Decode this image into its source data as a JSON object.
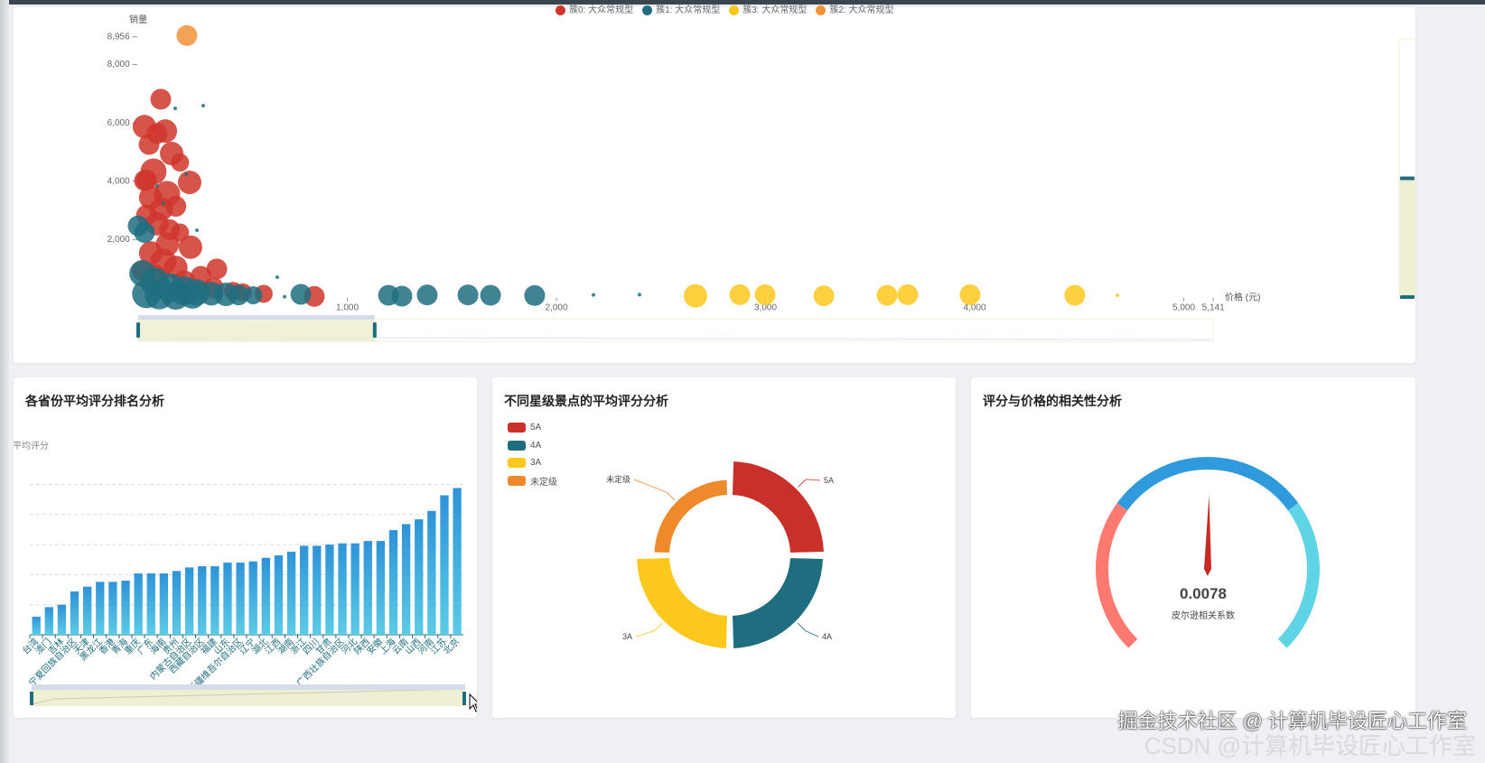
{
  "scatter_panel": {
    "legend": [
      {
        "label": "簇0: 大众常规型",
        "color": "#d0362b"
      },
      {
        "label": "簇1: 大众常规型",
        "color": "#1f6e80"
      },
      {
        "label": "簇3: 大众常规型",
        "color": "#fcc81c"
      },
      {
        "label": "簇2: 大众常规型",
        "color": "#f29338"
      }
    ]
  },
  "bar_panel": {
    "title": "各省份平均评分排名分析"
  },
  "donut_panel": {
    "title": "不同星级景点的平均评分分析"
  },
  "gauge_panel": {
    "title": "评分与价格的相关性分析"
  },
  "watermark": {
    "primary": "掘金技术社区 @ 计算机毕设匠心工作室",
    "secondary": "CSDN @计算机毕设匠心工作室"
  },
  "chart_data": [
    {
      "type": "scatter",
      "xlabel": "价格 (元)",
      "ylabel": "销量",
      "xlim": [
        0,
        5141
      ],
      "ylim": [
        0,
        8956
      ],
      "xticks": [
        "1,000",
        "2,000",
        "3,000",
        "4,000",
        "5,000",
        "5,141"
      ],
      "yticks": [
        "2,000",
        "4,000",
        "6,000",
        "8,000",
        "8,956"
      ],
      "xzoom_range_pct": [
        0,
        22
      ],
      "yzoom_range_pct": [
        0,
        46
      ],
      "series": [
        {
          "name": "簇0: 大众常规型",
          "color": "#d0362b",
          "points": [
            [
              108,
              6770,
              5
            ],
            [
              30,
              5830,
              6
            ],
            [
              130,
              5680,
              6
            ],
            [
              52,
              5220,
              5
            ],
            [
              160,
              4910,
              6
            ],
            [
              90,
              5600,
              5
            ],
            [
              200,
              4600,
              4
            ],
            [
              73,
              4290,
              7
            ],
            [
              30,
              3980,
              5
            ],
            [
              246,
              3920,
              6
            ],
            [
              138,
              3520,
              7
            ],
            [
              60,
              3400,
              6
            ],
            [
              110,
              3000,
              6
            ],
            [
              180,
              3100,
              5
            ],
            [
              40,
              2800,
              5
            ],
            [
              90,
              2500,
              6
            ],
            [
              150,
              2300,
              5
            ],
            [
              200,
              2200,
              4
            ],
            [
              250,
              1700,
              6
            ],
            [
              60,
              1500,
              6
            ],
            [
              120,
              1200,
              7
            ],
            [
              180,
              1000,
              6
            ],
            [
              376,
              950,
              5
            ],
            [
              300,
              700,
              5
            ],
            [
              20,
              900,
              5
            ],
            [
              454,
              200,
              4
            ],
            [
              500,
              150,
              4
            ],
            [
              600,
              100,
              4
            ],
            [
              842,
              10,
              5
            ],
            [
              80,
              700,
              6
            ],
            [
              220,
              500,
              6
            ],
            [
              360,
              300,
              5
            ],
            [
              140,
              1800,
              6
            ],
            [
              40,
              4000,
              5
            ]
          ]
        },
        {
          "name": "簇1: 大众常规型",
          "color": "#1f6e80",
          "points": [
            [
              0,
              2430,
              5
            ],
            [
              30,
              2200,
              5
            ],
            [
              20,
              800,
              7
            ],
            [
              80,
              500,
              8
            ],
            [
              150,
              300,
              8
            ],
            [
              220,
              200,
              8
            ],
            [
              280,
              150,
              7
            ],
            [
              350,
              100,
              6
            ],
            [
              420,
              80,
              6
            ],
            [
              40,
              100,
              8
            ],
            [
              100,
              60,
              8
            ],
            [
              180,
              50,
              8
            ],
            [
              260,
              40,
              7
            ],
            [
              480,
              60,
              5
            ],
            [
              550,
              50,
              4
            ],
            [
              778,
              80,
              5
            ],
            [
              1197,
              50,
              5
            ],
            [
              1261,
              20,
              5
            ],
            [
              1382,
              60,
              5
            ],
            [
              1577,
              60,
              5
            ],
            [
              1685,
              50,
              5
            ],
            [
              1896,
              40,
              5
            ],
            [
              2177,
              60,
              1
            ],
            [
              2397,
              70,
              1
            ],
            [
              177,
              6460,
              1
            ],
            [
              311,
              6550,
              1
            ],
            [
              665,
              670,
              1
            ],
            [
              281,
              2280,
              1
            ],
            [
              230,
              4200,
              1
            ],
            [
              120,
              3200,
              1
            ],
            [
              90,
              3800,
              1
            ],
            [
              700,
              0,
              1
            ]
          ]
        },
        {
          "name": "簇3: 大众常规型",
          "color": "#fcc81c",
          "points": [
            [
              2665,
              30,
              6
            ],
            [
              2877,
              70,
              5
            ],
            [
              2998,
              70,
              5
            ],
            [
              3279,
              30,
              5
            ],
            [
              3581,
              50,
              5
            ],
            [
              3680,
              70,
              5
            ],
            [
              3978,
              70,
              5
            ],
            [
              4479,
              50,
              5
            ],
            [
              4683,
              50,
              1
            ]
          ]
        },
        {
          "name": "簇2: 大众常规型",
          "color": "#f29338",
          "points": [
            [
              233,
              8956,
              5
            ]
          ]
        }
      ]
    },
    {
      "type": "bar",
      "title": "各省份平均评分排名分析",
      "ylabel": "平均评分",
      "ylim": [
        3.5,
        4.75
      ],
      "zoom_range_pct": [
        0,
        100
      ],
      "categories": [
        "台湾",
        "澳门",
        "吉林",
        "宁夏回族自治区",
        "天津",
        "黑龙江",
        "香港",
        "青海",
        "重庆",
        "广东",
        "海南",
        "贵州",
        "内蒙古自治区",
        "西藏自治区",
        "福建",
        "山东",
        "新疆维吾尔自治区",
        "辽宁",
        "湖北",
        "江西",
        "湖南",
        "浙江",
        "四川",
        "甘肃",
        "广西壮族自治区",
        "河北",
        "陕西",
        "安徽",
        "上海",
        "云南",
        "山西",
        "河南",
        "江苏",
        "北京"
      ],
      "values": [
        3.65,
        3.73,
        3.75,
        3.86,
        3.9,
        3.94,
        3.94,
        3.95,
        4.01,
        4.01,
        4.01,
        4.03,
        4.06,
        4.07,
        4.07,
        4.1,
        4.1,
        4.11,
        4.14,
        4.16,
        4.19,
        4.24,
        4.24,
        4.25,
        4.26,
        4.26,
        4.28,
        4.28,
        4.37,
        4.42,
        4.46,
        4.53,
        4.66,
        4.72
      ]
    },
    {
      "type": "pie",
      "title": "不同星级景点的平均评分分析",
      "rose": "area",
      "slices": [
        {
          "name": "5A",
          "value": 4.6,
          "color": "#c9302a"
        },
        {
          "name": "4A",
          "value": 4.55,
          "color": "#1f6e80"
        },
        {
          "name": "3A",
          "value": 4.55,
          "color": "#fcc81c"
        },
        {
          "name": "未定级",
          "value": 3.5,
          "color": "#ef8a2c"
        }
      ]
    },
    {
      "type": "gauge",
      "value": 0.0078,
      "value_label": "0.0078",
      "label": "皮尔逊相关系数",
      "min": -1,
      "max": 1,
      "bands": [
        {
          "to": -0.4,
          "color": "#fe7a70"
        },
        {
          "to": 0.4,
          "color": "#2f9bdc"
        },
        {
          "to": 1,
          "color": "#5fd4e5"
        }
      ]
    }
  ]
}
